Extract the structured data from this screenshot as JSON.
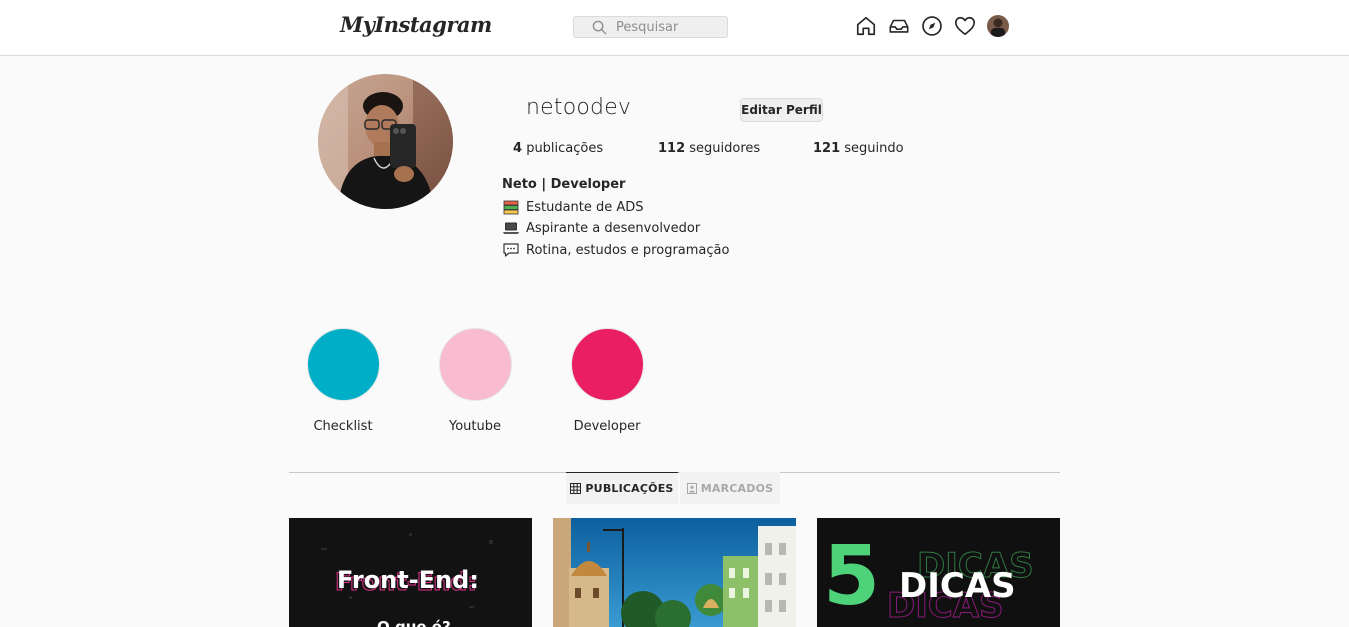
{
  "header": {
    "logo": "MyInstagram",
    "search_placeholder": "Pesquisar",
    "icons": [
      "home-icon",
      "inbox-icon",
      "explore-icon",
      "heart-icon",
      "profile-avatar"
    ]
  },
  "profile": {
    "username": "netoodev",
    "edit_button": "Editar Perfil",
    "stats": {
      "posts_count": "4",
      "posts_label": "publicações",
      "followers_count": "112",
      "followers_label": "seguidores",
      "following_count": "121",
      "following_label": "seguindo"
    },
    "full_name": "Neto | Developer",
    "bio": [
      {
        "icon": "books-icon",
        "text": "Estudante de ADS"
      },
      {
        "icon": "laptop-icon",
        "text": "Aspirante a desenvolvedor"
      },
      {
        "icon": "speech-bubble-icon",
        "text": "Rotina, estudos e programação"
      }
    ]
  },
  "highlights": [
    {
      "label": "Checklist",
      "color": "#00aec7"
    },
    {
      "label": "Youtube",
      "color": "#f8bbd0"
    },
    {
      "label": "Developer",
      "color": "#e91e63"
    }
  ],
  "tabs": [
    {
      "label": "PUBLICAÇÕES",
      "icon": "grid-icon",
      "active": true
    },
    {
      "label": "MARCADOS",
      "icon": "tagged-icon",
      "active": false
    }
  ],
  "posts": [
    {
      "title": "Front-End:",
      "subtitle": "O que é?"
    },
    {
      "alt": "city-photo"
    },
    {
      "number": "5",
      "word": "DICAS"
    }
  ],
  "colors": {
    "background": "#fafafa",
    "border": "#dbdbdb",
    "text": "#262626",
    "accent_green": "#4fd37a"
  }
}
